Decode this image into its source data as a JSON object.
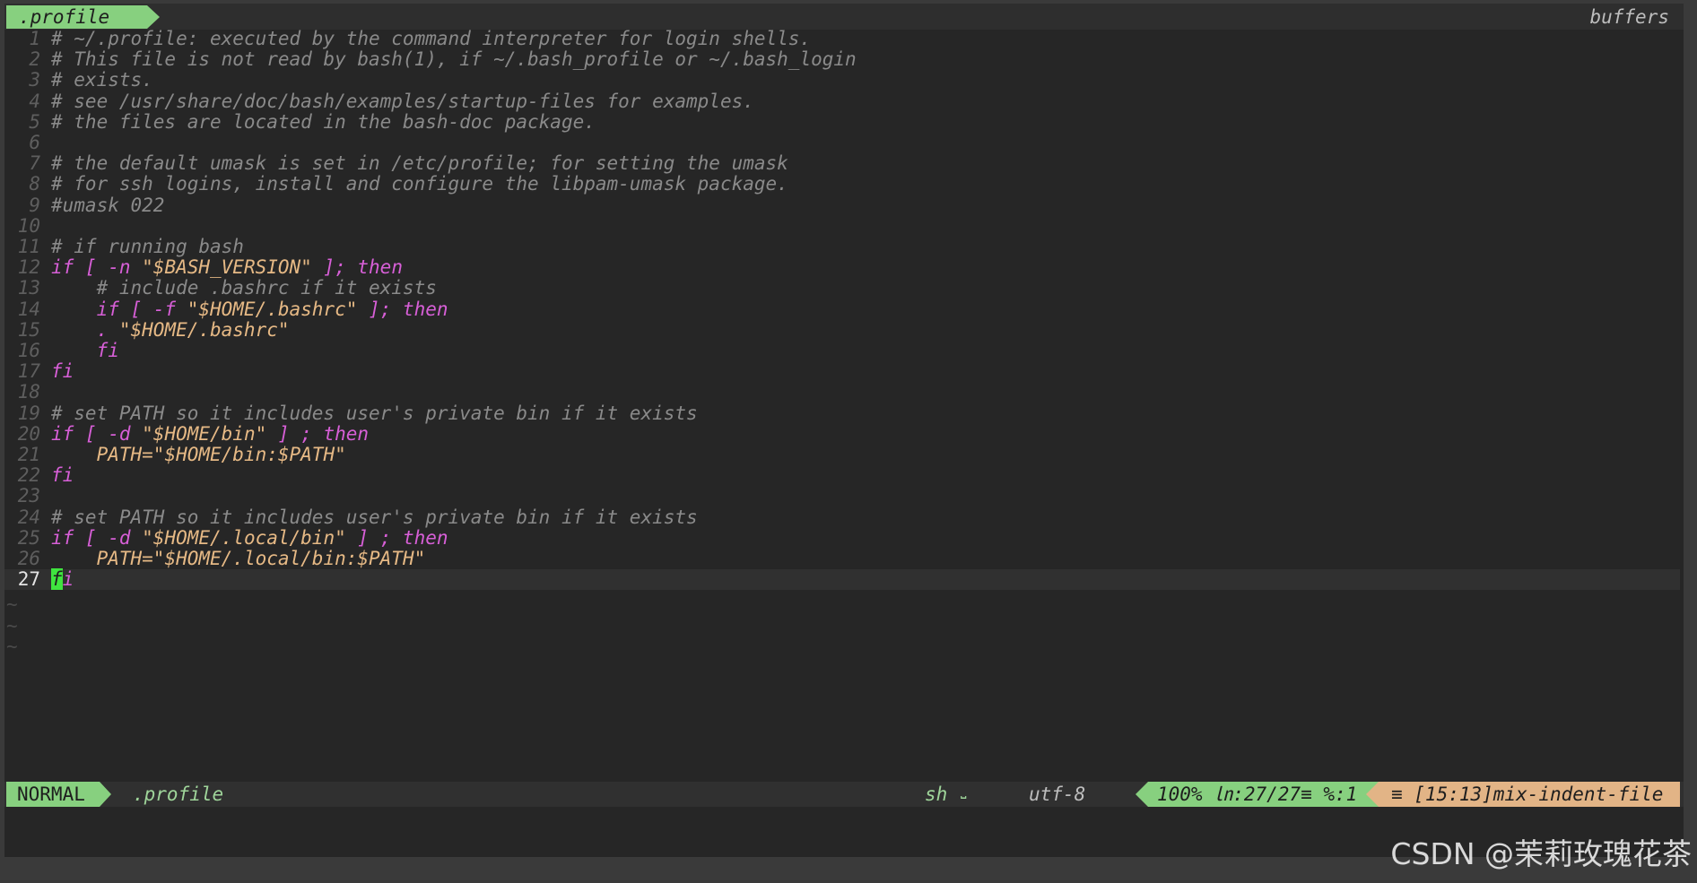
{
  "tabline": {
    "active_tab": ".profile",
    "right_label": "buffers"
  },
  "lines": [
    {
      "n": "1",
      "tokens": [
        {
          "t": "# ~/.profile: executed by the command interpreter for login shells.",
          "c": "comment"
        }
      ]
    },
    {
      "n": "2",
      "tokens": [
        {
          "t": "# This file is not read by bash(1), if ~/.bash_profile or ~/.bash_login",
          "c": "comment"
        }
      ]
    },
    {
      "n": "3",
      "tokens": [
        {
          "t": "# exists.",
          "c": "comment"
        }
      ]
    },
    {
      "n": "4",
      "tokens": [
        {
          "t": "# see /usr/share/doc/bash/examples/startup-files for examples.",
          "c": "comment"
        }
      ]
    },
    {
      "n": "5",
      "tokens": [
        {
          "t": "# the files are located in the bash-doc package.",
          "c": "comment"
        }
      ]
    },
    {
      "n": "6",
      "tokens": []
    },
    {
      "n": "7",
      "tokens": [
        {
          "t": "# the default umask is set in /etc/profile; for setting the umask",
          "c": "comment"
        }
      ]
    },
    {
      "n": "8",
      "tokens": [
        {
          "t": "# for ssh logins, install and configure the libpam-umask package.",
          "c": "comment"
        }
      ]
    },
    {
      "n": "9",
      "tokens": [
        {
          "t": "#umask 022",
          "c": "comment"
        }
      ]
    },
    {
      "n": "10",
      "tokens": []
    },
    {
      "n": "11",
      "tokens": [
        {
          "t": "# if running bash",
          "c": "comment"
        }
      ]
    },
    {
      "n": "12",
      "tokens": [
        {
          "t": "if [ -n ",
          "c": "kw"
        },
        {
          "t": "\"$BASH_VERSION\"",
          "c": "str"
        },
        {
          "t": " ]; then",
          "c": "kw"
        }
      ]
    },
    {
      "n": "13",
      "tokens": [
        {
          "t": "    # include .bashrc if it exists",
          "c": "comment"
        }
      ]
    },
    {
      "n": "14",
      "tokens": [
        {
          "t": "    if [ -f ",
          "c": "kw"
        },
        {
          "t": "\"$HOME/.bashrc\"",
          "c": "str"
        },
        {
          "t": " ]; then",
          "c": "kw"
        }
      ]
    },
    {
      "n": "15",
      "tokens": [
        {
          "t": "    . ",
          "c": "kw"
        },
        {
          "t": "\"$HOME/.bashrc\"",
          "c": "str"
        }
      ]
    },
    {
      "n": "16",
      "tokens": [
        {
          "t": "    fi",
          "c": "kw"
        }
      ]
    },
    {
      "n": "17",
      "tokens": [
        {
          "t": "fi",
          "c": "kw"
        }
      ]
    },
    {
      "n": "18",
      "tokens": []
    },
    {
      "n": "19",
      "tokens": [
        {
          "t": "# set PATH so it includes user's private bin if it exists",
          "c": "comment"
        }
      ]
    },
    {
      "n": "20",
      "tokens": [
        {
          "t": "if [ -d ",
          "c": "kw"
        },
        {
          "t": "\"$HOME/bin\"",
          "c": "str"
        },
        {
          "t": " ] ; then",
          "c": "kw"
        }
      ]
    },
    {
      "n": "21",
      "tokens": [
        {
          "t": "    PATH=",
          "c": "plain"
        },
        {
          "t": "\"$HOME/bin:$PATH\"",
          "c": "str"
        }
      ]
    },
    {
      "n": "22",
      "tokens": [
        {
          "t": "fi",
          "c": "kw"
        }
      ]
    },
    {
      "n": "23",
      "tokens": []
    },
    {
      "n": "24",
      "tokens": [
        {
          "t": "# set PATH so it includes user's private bin if it exists",
          "c": "comment"
        }
      ]
    },
    {
      "n": "25",
      "tokens": [
        {
          "t": "if [ -d ",
          "c": "kw"
        },
        {
          "t": "\"$HOME/.local/bin\"",
          "c": "str"
        },
        {
          "t": " ] ; then",
          "c": "kw"
        }
      ]
    },
    {
      "n": "26",
      "tokens": [
        {
          "t": "    PATH=",
          "c": "plain"
        },
        {
          "t": "\"$HOME/.local/bin:$PATH\"",
          "c": "str"
        }
      ]
    },
    {
      "n": "27",
      "tokens": [
        {
          "t": "f",
          "c": "cursor"
        },
        {
          "t": "i",
          "c": "kw"
        }
      ],
      "current": true
    }
  ],
  "tildes": [
    "~",
    "~",
    "~"
  ],
  "statusline": {
    "mode": "NORMAL",
    "filename": ".profile",
    "filetype": "sh",
    "fileformat_icon": "⎵",
    "encoding": "utf-8",
    "position": "100% ㏑:27/27≡ %:1",
    "warning": "≡ [15:13]mix-indent-file"
  },
  "watermark": "CSDN @茉莉玫瑰花茶",
  "colors": {
    "accent_green": "#87d07f",
    "warning_orange": "#e2b486",
    "keyword": "#d75fd7",
    "string": "#e6b985",
    "comment": "#8a8a8a",
    "cursor": "#3fe43f"
  }
}
